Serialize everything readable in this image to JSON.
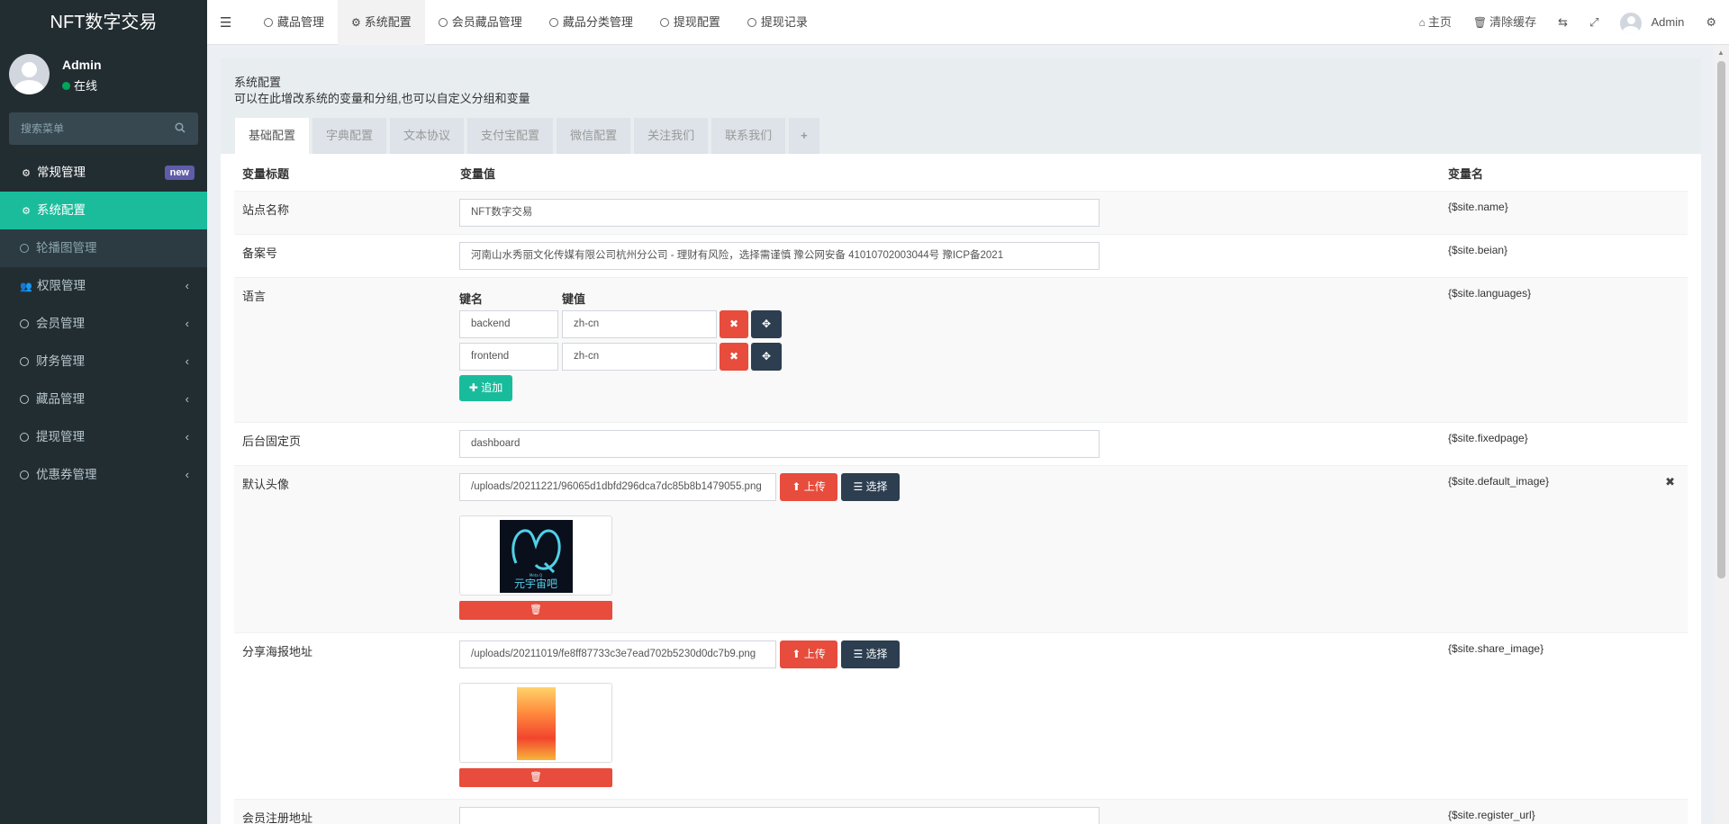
{
  "sidebar": {
    "logo": "NFT数字交易",
    "user": {
      "name": "Admin",
      "status": "在线"
    },
    "search_placeholder": "搜索菜单",
    "menu": [
      {
        "label": "常规管理",
        "badge": "new"
      },
      {
        "label": "系统配置"
      },
      {
        "label": "轮播图管理"
      },
      {
        "label": "权限管理"
      },
      {
        "label": "会员管理"
      },
      {
        "label": "财务管理"
      },
      {
        "label": "藏品管理"
      },
      {
        "label": "提现管理"
      },
      {
        "label": "优惠券管理"
      }
    ]
  },
  "topnav": {
    "tabs": [
      "藏品管理",
      "系统配置",
      "会员藏品管理",
      "藏品分类管理",
      "提现配置",
      "提现记录"
    ],
    "home": "主页",
    "clear_cache": "清除缓存",
    "user": "Admin"
  },
  "panel": {
    "title": "系统配置",
    "description": "可以在此增改系统的变量和分组,也可以自定义分组和变量",
    "tabs": [
      "基础配置",
      "字典配置",
      "文本协议",
      "支付宝配置",
      "微信配置",
      "关注我们",
      "联系我们"
    ],
    "headers": {
      "title": "变量标题",
      "value": "变量值",
      "name": "变量名"
    },
    "rows": {
      "name": {
        "title": "站点名称",
        "value": "NFT数字交易",
        "var": "{$site.name}"
      },
      "beian": {
        "title": "备案号",
        "value": "河南山水秀丽文化传媒有限公司杭州分公司 - 理财有风险，选择需谨慎      豫公网安备 41010702003044号           豫ICP备2021",
        "var": "{$site.beian}"
      },
      "languages": {
        "title": "语言",
        "var": "{$site.languages}",
        "key_header": "键名",
        "value_header": "键值",
        "items": [
          {
            "key": "backend",
            "value": "zh-cn"
          },
          {
            "key": "frontend",
            "value": "zh-cn"
          }
        ],
        "add_label": "追加"
      },
      "fixedpage": {
        "title": "后台固定页",
        "value": "dashboard",
        "var": "{$site.fixedpage}"
      },
      "default_image": {
        "title": "默认头像",
        "value": "/uploads/20211221/96065d1dbfd296dca7dc85b8b1479055.png",
        "var": "{$site.default_image}",
        "upload": "上传",
        "choose": "选择",
        "logo_text": "元宇宙吧",
        "logo_sub": "Meta Q"
      },
      "share_image": {
        "title": "分享海报地址",
        "value": "/uploads/20211019/fe8ff87733c3e7ead702b5230d0dc7b9.png",
        "var": "{$site.share_image}",
        "upload": "上传",
        "choose": "选择"
      },
      "register_url": {
        "title": "会员注册地址",
        "var": "{$site.register_url}"
      }
    }
  },
  "colors": {
    "sidebar_bg": "#222d32",
    "active": "#1abc9c",
    "danger": "#e74c3c",
    "dark": "#2c3e50",
    "badge": "#605ca8"
  }
}
